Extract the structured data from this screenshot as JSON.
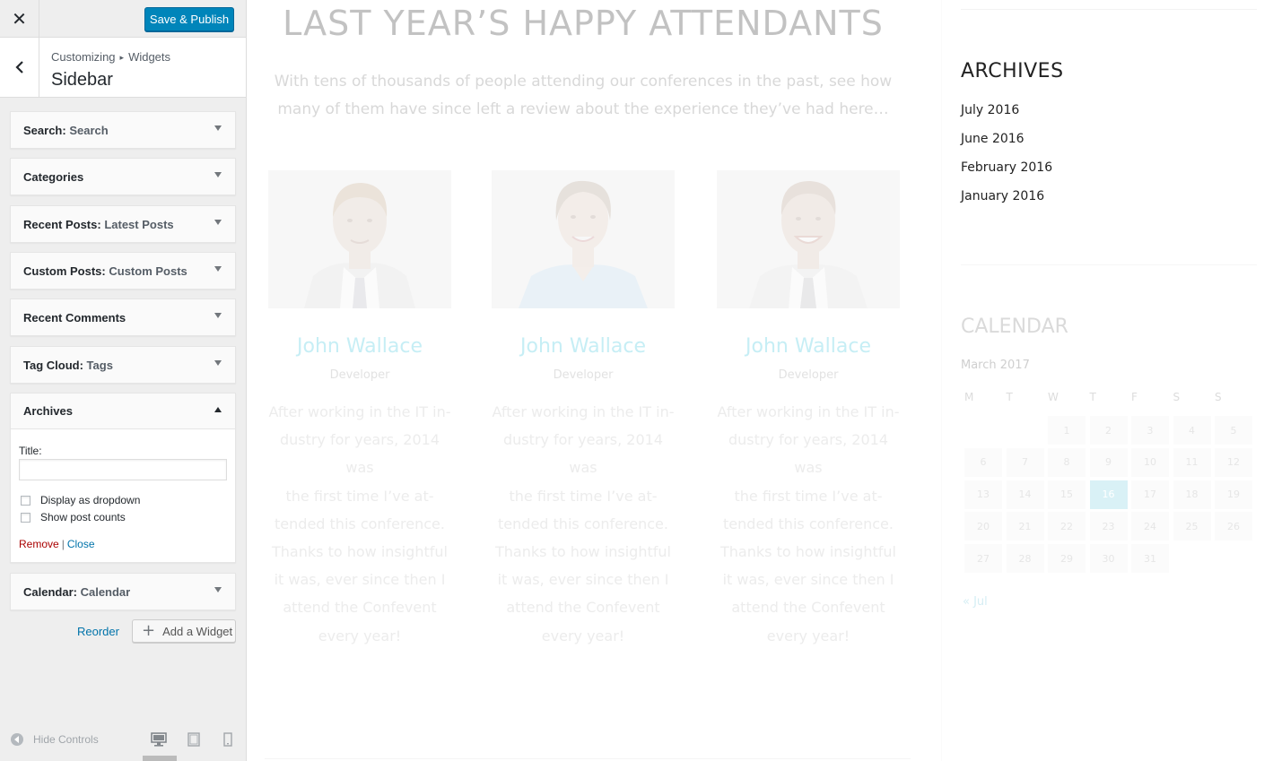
{
  "customizer": {
    "close_symbol": "✕",
    "save_label": "Save & Publish",
    "breadcrumb": [
      "Customizing",
      "Widgets"
    ],
    "breadcrumb_separator": "▸",
    "section_title": "Sidebar",
    "widgets": [
      {
        "name": "Search",
        "subtitle": "Search",
        "expanded": false
      },
      {
        "name": "Categories",
        "subtitle": "",
        "expanded": false
      },
      {
        "name": "Recent Posts",
        "subtitle": "Latest Posts",
        "expanded": false
      },
      {
        "name": "Custom Posts",
        "subtitle": "Custom Posts",
        "expanded": false
      },
      {
        "name": "Recent Comments",
        "subtitle": "",
        "expanded": false
      },
      {
        "name": "Tag Cloud",
        "subtitle": "Tags",
        "expanded": false
      },
      {
        "name": "Archives",
        "subtitle": "",
        "expanded": true
      },
      {
        "name": "Calendar",
        "subtitle": "Calendar",
        "expanded": false
      }
    ],
    "archives_form": {
      "title_label": "Title:",
      "title_value": "",
      "dropdown_label": "Display as dropdown",
      "dropdown_checked": false,
      "counts_label": "Show post counts",
      "counts_checked": false,
      "remove_label": "Remove",
      "separator": "|",
      "close_label": "Close"
    },
    "reorder_label": "Reorder",
    "add_widget_label": "Add a Widget",
    "add_widget_symbol": "+",
    "hide_controls_label": "Hide Controls",
    "active_device": "desktop",
    "colors": {
      "primary": "#0085ba",
      "link": "#0073aa",
      "remove": "#aa0000"
    }
  },
  "preview": {
    "heading": "LAST YEAR’S HAPPY ATTENDANTS",
    "intro": "With tens of thousands of people attending our conferences in the past, see how many of them have since left a review about the experience they’ve had here…",
    "testimonials": [
      {
        "name": "John Wallace",
        "role": "Developer",
        "photo": "man-smiling-tie",
        "lines": [
          "After working in the IT in-",
          "dustry for years, 2014 was",
          "the first time I’ve at-",
          "tended this conference.",
          "Thanks to how insightful",
          "it was, ever since then I",
          "attend the Confevent",
          "every year!"
        ]
      },
      {
        "name": "John Wallace",
        "role": "Developer",
        "photo": "woman-smiling-blue-shirt",
        "lines": [
          "After working in the IT in-",
          "dustry for years, 2014 was",
          "the first time I’ve at-",
          "tended this conference.",
          "Thanks to how insightful",
          "it was, ever since then I",
          "attend the Confevent",
          "every year!"
        ]
      },
      {
        "name": "John Wallace",
        "role": "Developer",
        "photo": "man-grinning-tie",
        "lines": [
          "After working in the IT in-",
          "dustry for years, 2014 was",
          "the first time I’ve at-",
          "tended this conference.",
          "Thanks to how insightful",
          "it was, ever since then I",
          "attend the Confevent",
          "every year!"
        ]
      }
    ],
    "archives": {
      "title": "ARCHIVES",
      "links": [
        "July 2016",
        "June 2016",
        "February 2016",
        "January 2016"
      ]
    },
    "calendar": {
      "title": "CALENDAR",
      "month": "March 2017",
      "weekdays": [
        "M",
        "T",
        "W",
        "T",
        "F",
        "S",
        "S"
      ],
      "weeks": [
        [
          "",
          "",
          "1",
          "2",
          "3",
          "4",
          "5"
        ],
        [
          "6",
          "7",
          "8",
          "9",
          "10",
          "11",
          "12"
        ],
        [
          "13",
          "14",
          "15",
          "16",
          "17",
          "18",
          "19"
        ],
        [
          "20",
          "21",
          "22",
          "23",
          "24",
          "25",
          "26"
        ],
        [
          "27",
          "28",
          "29",
          "30",
          "31",
          "",
          ""
        ]
      ],
      "today": "16",
      "prev_link": "« Jul"
    }
  }
}
